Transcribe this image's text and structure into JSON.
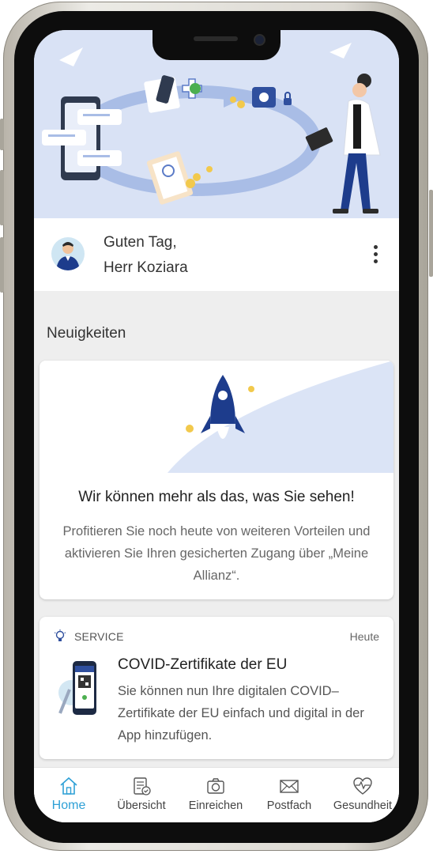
{
  "greeting": {
    "line1": "Guten Tag,",
    "line2": "Herr Koziara"
  },
  "news": {
    "section_title": "Neuigkeiten",
    "title": "Wir können mehr als das, was Sie sehen!",
    "body": "Profitieren Sie noch heute von weiteren Vorteilen und aktivieren Sie Ihren gesicherten Zugang über „Meine Allianz“."
  },
  "service": {
    "label": "SERVICE",
    "date": "Heute",
    "title": "COVID-Zertifikate der EU",
    "body": "Sie können nun Ihre digitalen COVID–Zertifikate der EU einfach und digital in der App hinzufügen."
  },
  "tabs": [
    {
      "label": "Home",
      "icon": "home-icon",
      "active": true
    },
    {
      "label": "Übersicht",
      "icon": "checklist-icon",
      "active": false
    },
    {
      "label": "Einreichen",
      "icon": "camera-icon",
      "active": false
    },
    {
      "label": "Postfach",
      "icon": "mail-icon",
      "active": false
    },
    {
      "label": "Gesundheit",
      "icon": "heart-pulse-icon",
      "active": false
    }
  ],
  "colors": {
    "accent": "#2ea0d6",
    "hero_bg": "#d9e2f5",
    "navy": "#1d3c8c"
  }
}
